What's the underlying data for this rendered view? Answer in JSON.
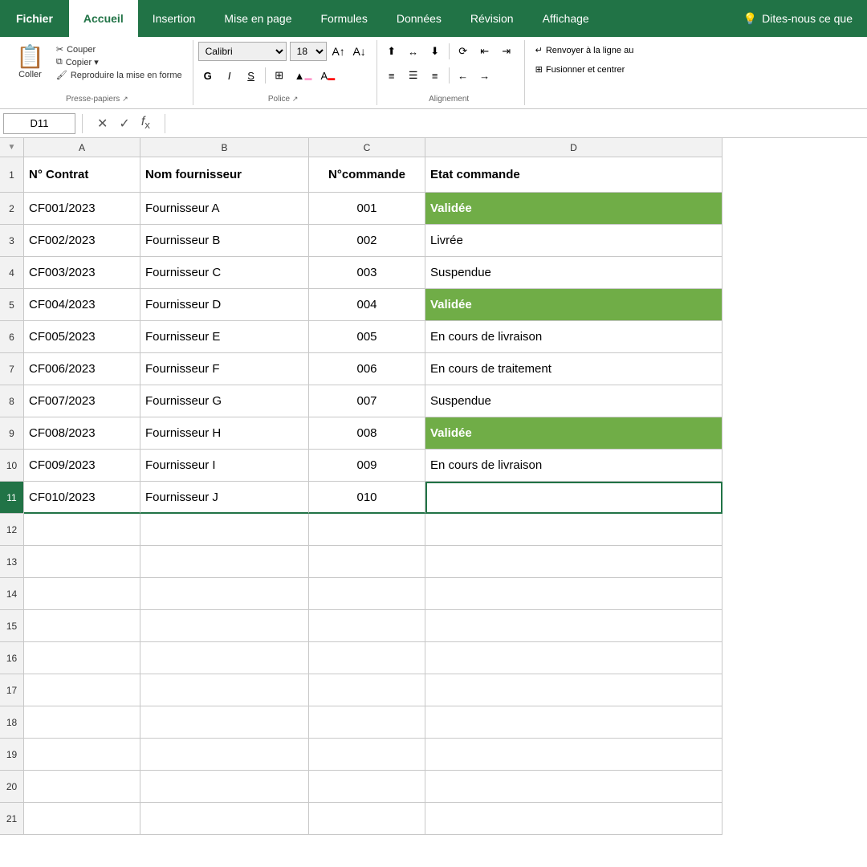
{
  "ribbon": {
    "tabs": [
      {
        "id": "fichier",
        "label": "Fichier",
        "active": false
      },
      {
        "id": "accueil",
        "label": "Accueil",
        "active": true
      },
      {
        "id": "insertion",
        "label": "Insertion",
        "active": false
      },
      {
        "id": "mise-en-page",
        "label": "Mise en page",
        "active": false
      },
      {
        "id": "formules",
        "label": "Formules",
        "active": false
      },
      {
        "id": "donnees",
        "label": "Données",
        "active": false
      },
      {
        "id": "revision",
        "label": "Révision",
        "active": false
      },
      {
        "id": "affichage",
        "label": "Affichage",
        "active": false
      }
    ],
    "tip_label": "Dites-nous ce que",
    "clipboard": {
      "group_label": "Presse-papiers",
      "coller": "Coller",
      "couper": "Couper",
      "copier": "Copier",
      "reproduire": "Reproduire la mise en forme"
    },
    "font": {
      "group_label": "Police",
      "font_name": "Calibri",
      "font_size": "18",
      "bold": "G",
      "italic": "I",
      "underline": "S"
    },
    "alignment": {
      "group_label": "Alignement",
      "wrap_label": "Renvoyer à la ligne au",
      "merge_label": "Fusionner et centrer"
    }
  },
  "formula_bar": {
    "cell_ref": "D11",
    "formula": ""
  },
  "spreadsheet": {
    "columns": [
      {
        "id": "row-num",
        "label": ""
      },
      {
        "id": "A",
        "label": "A"
      },
      {
        "id": "B",
        "label": "B"
      },
      {
        "id": "C",
        "label": "C"
      },
      {
        "id": "D",
        "label": "D"
      }
    ],
    "headers": {
      "A": "N° Contrat",
      "B": "Nom fournisseur",
      "C": "N°commande",
      "D": "Etat commande"
    },
    "rows": [
      {
        "num": 2,
        "A": "CF001/2023",
        "B": "Fournisseur A",
        "C": "001",
        "D": "Validée",
        "D_green": true
      },
      {
        "num": 3,
        "A": "CF002/2023",
        "B": "Fournisseur B",
        "C": "002",
        "D": "Livrée",
        "D_green": false
      },
      {
        "num": 4,
        "A": "CF003/2023",
        "B": "Fournisseur C",
        "C": "003",
        "D": "Suspendue",
        "D_green": false
      },
      {
        "num": 5,
        "A": "CF004/2023",
        "B": "Fournisseur D",
        "C": "004",
        "D": "Validée",
        "D_green": true
      },
      {
        "num": 6,
        "A": "CF005/2023",
        "B": "Fournisseur E",
        "C": "005",
        "D": "En cours de livraison",
        "D_green": false
      },
      {
        "num": 7,
        "A": "CF006/2023",
        "B": "Fournisseur F",
        "C": "006",
        "D": "En cours de traitement",
        "D_green": false
      },
      {
        "num": 8,
        "A": "CF007/2023",
        "B": "Fournisseur G",
        "C": "007",
        "D": "Suspendue",
        "D_green": false
      },
      {
        "num": 9,
        "A": "CF008/2023",
        "B": "Fournisseur H",
        "C": "008",
        "D": "Validée",
        "D_green": true
      },
      {
        "num": 10,
        "A": "CF009/2023",
        "B": "Fournisseur I",
        "C": "009",
        "D": "En cours de livraison",
        "D_green": false
      },
      {
        "num": 11,
        "A": "CF010/2023",
        "B": "Fournisseur J",
        "C": "010",
        "D": "",
        "D_green": false,
        "selected": true
      },
      {
        "num": 12,
        "A": "",
        "B": "",
        "C": "",
        "D": "",
        "D_green": false
      },
      {
        "num": 13,
        "A": "",
        "B": "",
        "C": "",
        "D": "",
        "D_green": false
      },
      {
        "num": 14,
        "A": "",
        "B": "",
        "C": "",
        "D": "",
        "D_green": false
      },
      {
        "num": 15,
        "A": "",
        "B": "",
        "C": "",
        "D": "",
        "D_green": false
      },
      {
        "num": 16,
        "A": "",
        "B": "",
        "C": "",
        "D": "",
        "D_green": false
      },
      {
        "num": 17,
        "A": "",
        "B": "",
        "C": "",
        "D": "",
        "D_green": false
      },
      {
        "num": 18,
        "A": "",
        "B": "",
        "C": "",
        "D": "",
        "D_green": false
      },
      {
        "num": 19,
        "A": "",
        "B": "",
        "C": "",
        "D": "",
        "D_green": false
      },
      {
        "num": 20,
        "A": "",
        "B": "",
        "C": "",
        "D": "",
        "D_green": false
      },
      {
        "num": 21,
        "A": "",
        "B": "",
        "C": "",
        "D": "",
        "D_green": false
      }
    ],
    "colors": {
      "green_bg": "#70ad47",
      "green_text": "#ffffff",
      "header_bg": "#217346"
    }
  }
}
